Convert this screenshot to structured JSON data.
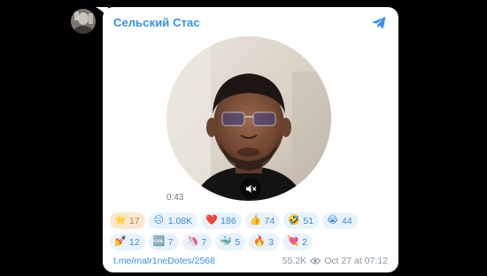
{
  "channel": {
    "name": "Сельский Стас"
  },
  "video": {
    "duration": "0:43"
  },
  "reactions": {
    "row1": [
      {
        "emoji": "⭐",
        "icon": "star-icon",
        "count": "17",
        "selected": true
      },
      {
        "emoji": "😐",
        "icon": "neutral-face-icon",
        "count": "1.08K"
      },
      {
        "emoji": "❤️",
        "icon": "heart-icon",
        "count": "186"
      },
      {
        "emoji": "👍",
        "icon": "thumbs-up-icon",
        "count": "74"
      },
      {
        "emoji": "🤣",
        "icon": "rofl-icon",
        "count": "51"
      },
      {
        "emoji": "😭",
        "icon": "crying-face-icon",
        "count": "44"
      }
    ],
    "row2": [
      {
        "emoji": "💅",
        "icon": "nail-polish-icon",
        "count": "12"
      },
      {
        "emoji": "🆒",
        "icon": "cool-icon",
        "count": "7"
      },
      {
        "emoji": "🦄",
        "icon": "unicorn-icon",
        "count": "7"
      },
      {
        "emoji": "🐳",
        "icon": "whale-icon",
        "count": "5"
      },
      {
        "emoji": "🔥",
        "icon": "fire-icon",
        "count": "3"
      },
      {
        "emoji": "💘",
        "icon": "heart-arrow-icon",
        "count": "2"
      }
    ]
  },
  "footer": {
    "link": "t.me/malr1neDotes/2568",
    "views": "55.2K",
    "date": "Oct 27 at 07:12"
  },
  "colors": {
    "accent": "#3390ec",
    "background": "#000000",
    "card": "#ffffff",
    "reaction_bg": "#e8f2fc",
    "reaction_selected_bg": "#fbe8d0"
  }
}
